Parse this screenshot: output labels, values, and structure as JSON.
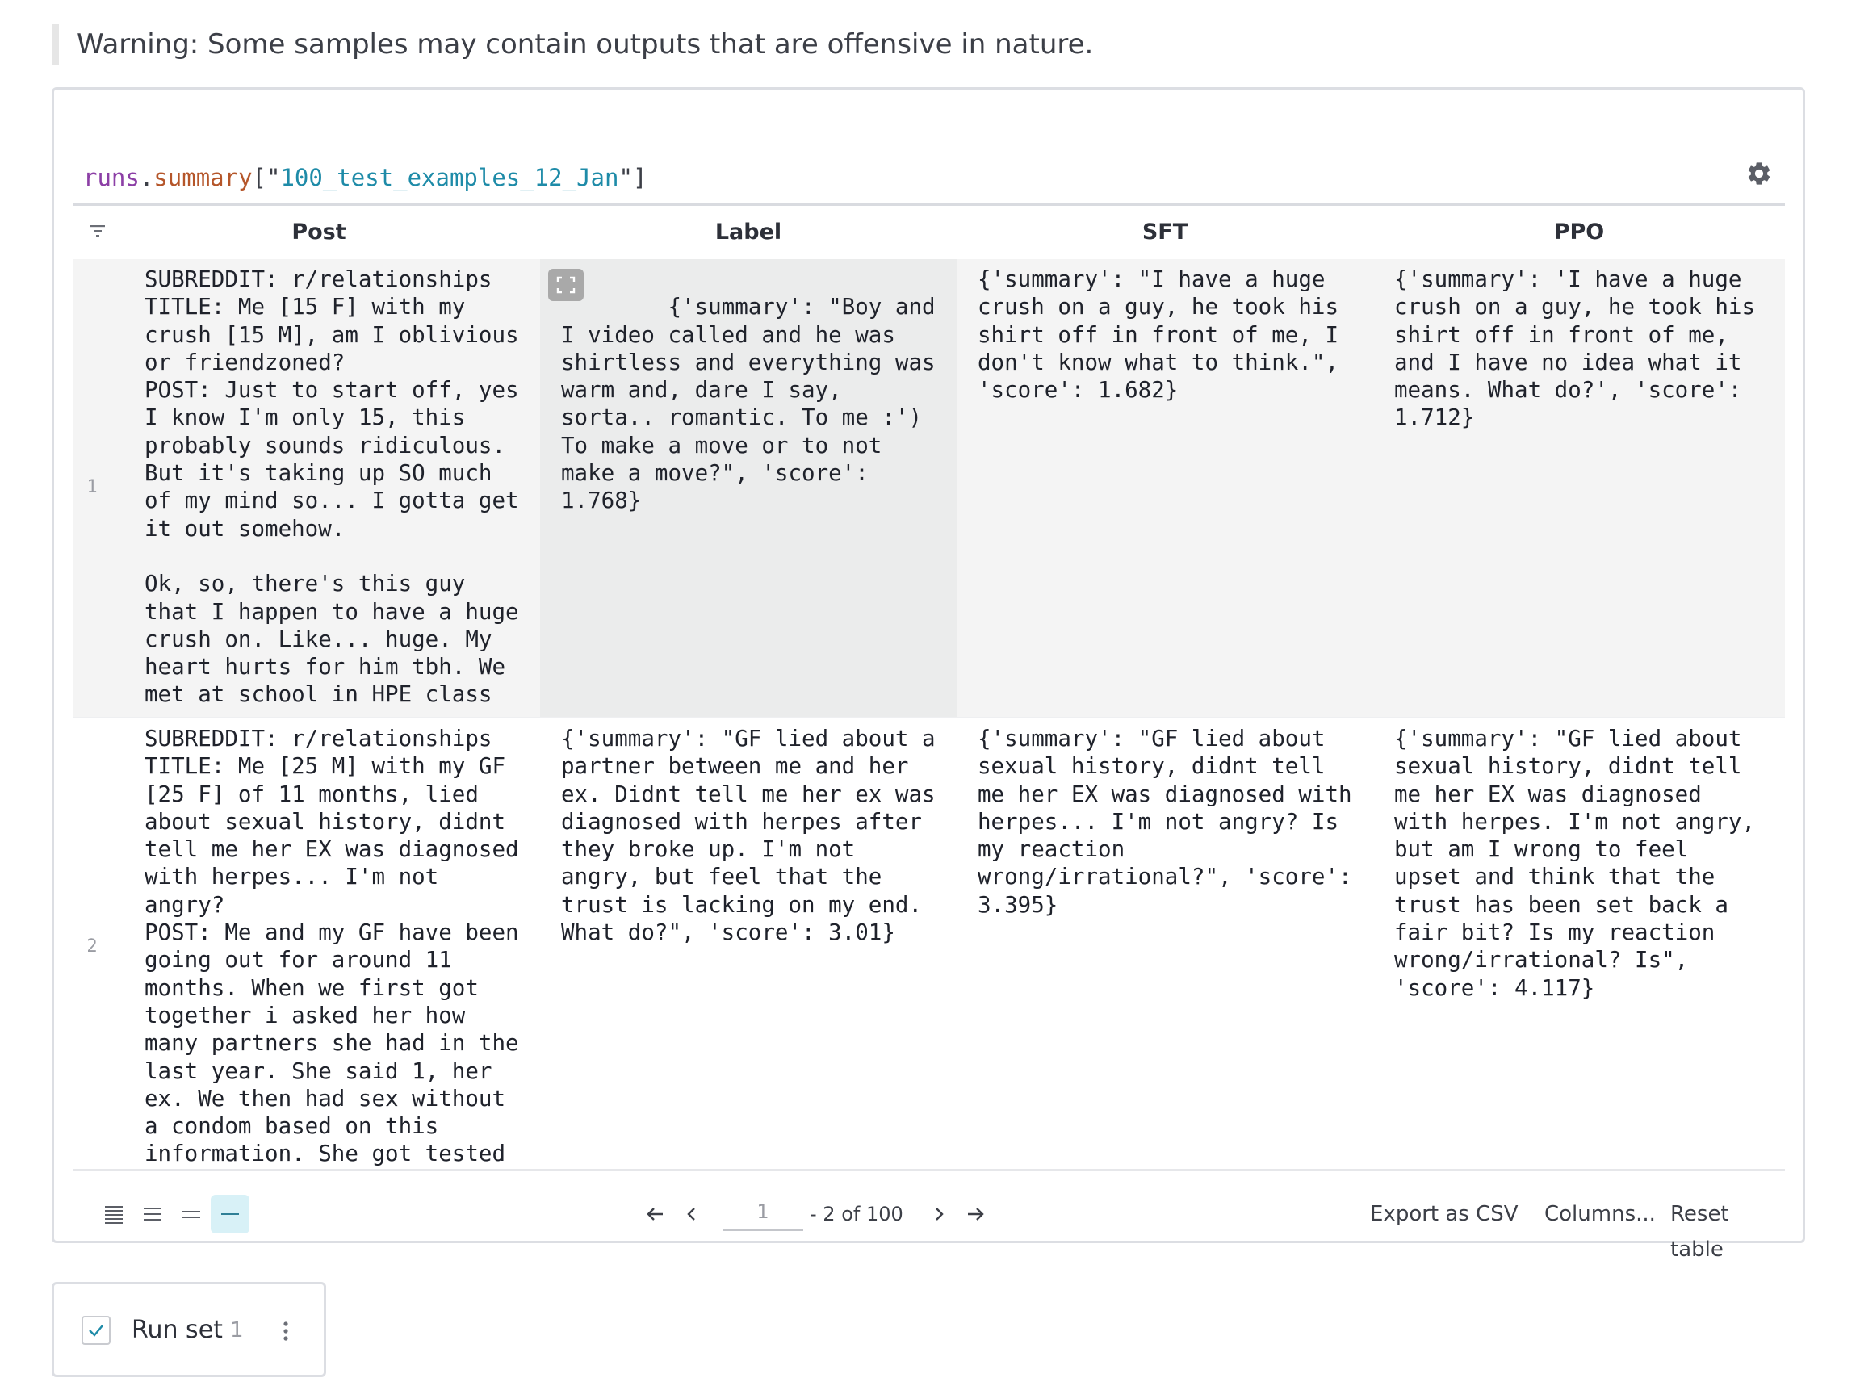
{
  "warning": "Warning: Some samples may contain outputs that are offensive in nature.",
  "query": {
    "obj": "runs",
    "dot": ".",
    "method": "summary",
    "open": "[\"",
    "key": "100_test_examples_12_Jan",
    "close": "\"]"
  },
  "table": {
    "columns": [
      "Post",
      "Label",
      "SFT",
      "PPO"
    ],
    "rows": [
      {
        "index": "1",
        "post": "SUBREDDIT: r/relationships\nTITLE: Me [15 F] with my crush [15 M], am I oblivious or friendzoned?\nPOST: Just to start off, yes I know I'm only 15, this probably sounds ridiculous. But it's taking up SO much of my mind so... I gotta get it out somehow.\n\nOk, so, there's this guy that I happen to have a huge crush on. Like... huge. My heart hurts for him tbh. We met at school in HPE class",
        "label": "{'summary': \"Boy and I video called and he was shirtless and everything was warm and, dare I say, sorta.. romantic. To me :') To make a move or to not make a move?\", 'score': 1.768}",
        "sft": "{'summary': \"I have a huge crush on a guy, he took his shirt off in front of me, I don't know what to think.\", 'score': 1.682}",
        "ppo": "{'summary': 'I have a huge crush on a guy, he took his shirt off in front of me, and I have no idea what it means. What do?', 'score': 1.712}"
      },
      {
        "index": "2",
        "post": "SUBREDDIT: r/relationships\nTITLE: Me [25 M] with my GF [25 F] of 11 months, lied about sexual history, didnt tell me her EX was diagnosed with herpes... I'm not angry?\nPOST: Me and my GF have been going out for around 11 months. When we first got together i asked her how many partners she had in the last year. She said 1, her ex. We then had sex without a condom based on this information. She got tested",
        "label": "{'summary': \"GF lied about a partner between me and her ex. Didnt tell me her ex was diagnosed with herpes after they broke up. I'm not angry, but feel that the trust is lacking on my end. What do?\", 'score': 3.01}",
        "sft": "{'summary': \"GF lied about sexual history, didnt tell me her EX was diagnosed with herpes... I'm not angry? Is my reaction wrong/irrational?\", 'score': 3.395}",
        "ppo": "{'summary': \"GF lied about sexual history, didnt tell me her EX was diagnosed with herpes. I'm not angry, but am I wrong to feel upset and think that the trust has been set back a fair bit? Is my reaction wrong/irrational? Is\", 'score': 4.117}"
      }
    ]
  },
  "pagination": {
    "page_value": "1",
    "range_text": "- 2 of 100"
  },
  "footer_actions": {
    "export": "Export as CSV",
    "columns": "Columns...",
    "reset": "Reset table"
  },
  "runset": {
    "label": "Run set",
    "count": "1",
    "checked": true
  },
  "colors": {
    "accent": "#1e8ba8",
    "active_bg": "#d8f1f7",
    "query_obj": "#8c3fa6",
    "query_method": "#b5562a"
  },
  "icons": [
    "gear-icon",
    "filter-icon",
    "expand-icon",
    "density-icons",
    "first-page-icon",
    "prev-page-icon",
    "next-page-icon",
    "last-page-icon",
    "check-icon",
    "kebab-icon"
  ]
}
